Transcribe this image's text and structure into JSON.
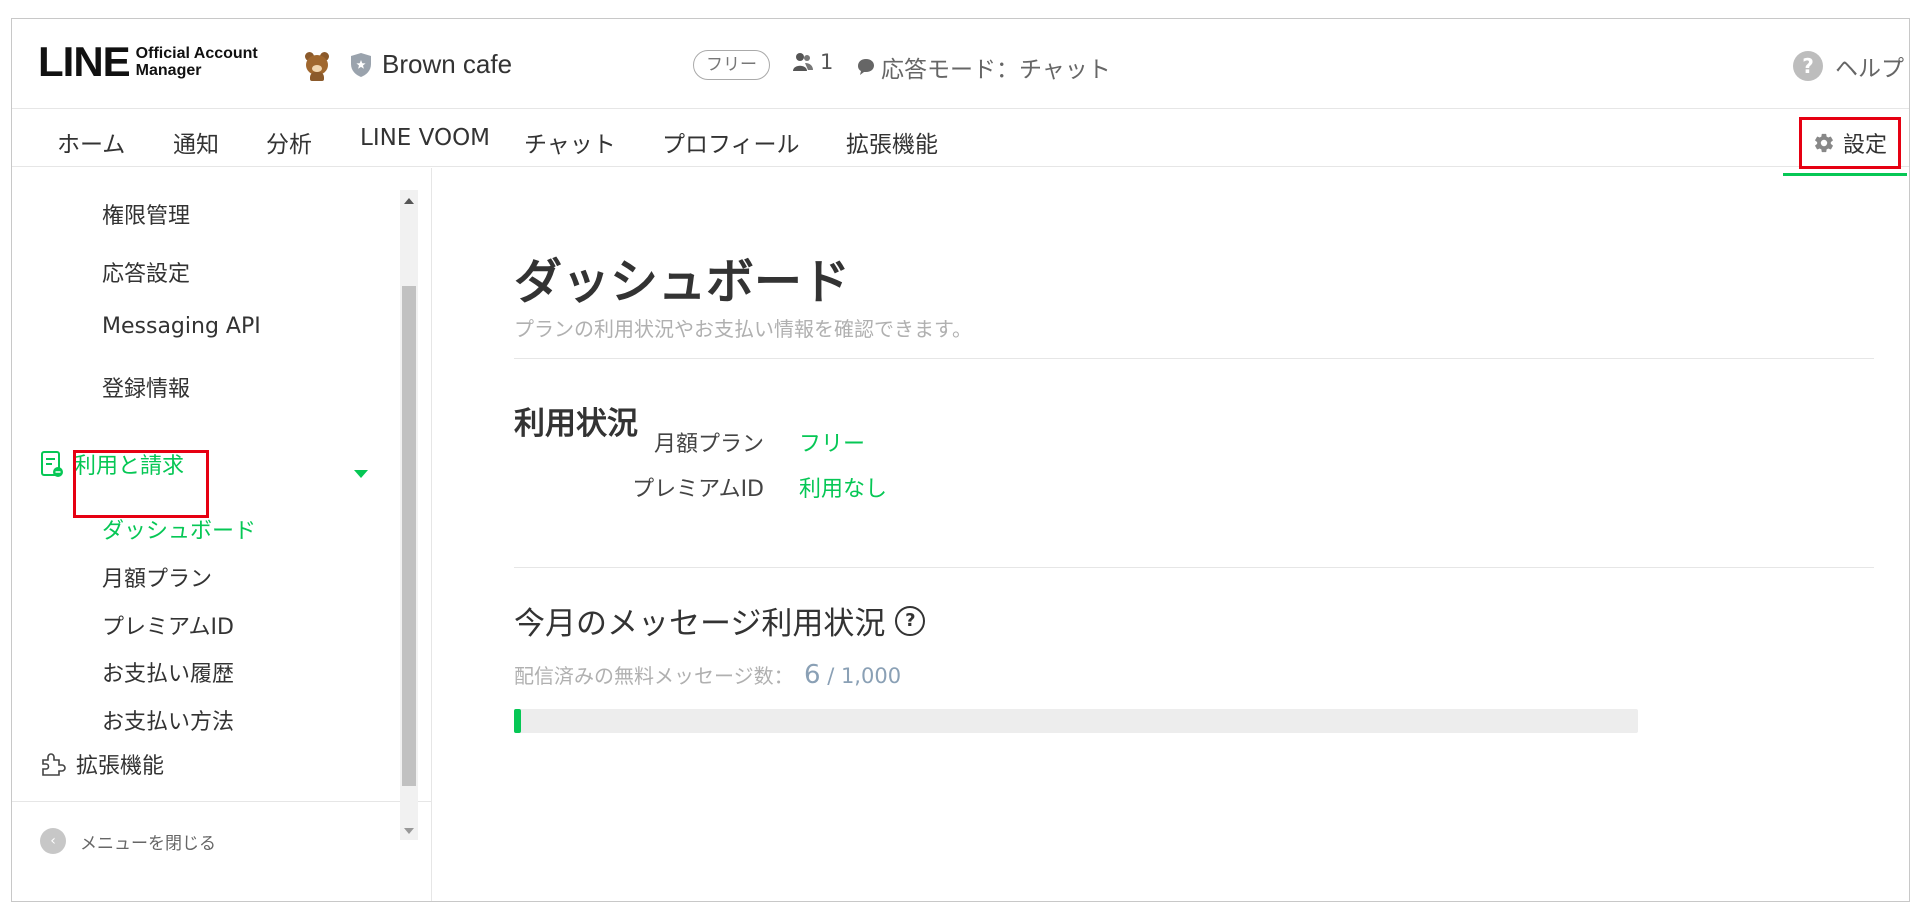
{
  "header": {
    "logo_main": "LINE",
    "logo_sub_line1": "Official Account",
    "logo_sub_line2": "Manager",
    "account_name": "Brown cafe",
    "plan_badge": "フリー",
    "friends_count": "1",
    "response_mode": "応答モード：チャット",
    "help": "ヘルプ"
  },
  "nav": {
    "items": [
      "ホーム",
      "通知",
      "分析",
      "LINE VOOM",
      "チャット",
      "プロフィール",
      "拡張機能"
    ],
    "settings": "設定"
  },
  "sidebar": {
    "items_top": [
      "権限管理",
      "応答設定",
      "Messaging API",
      "登録情報"
    ],
    "usage_section": "利用と請求",
    "usage_items": [
      "ダッシュボード",
      "月額プラン",
      "プレミアムID",
      "お支払い履歴",
      "お支払い方法"
    ],
    "extensions": "拡張機能",
    "close_menu": "メニューを閉じる"
  },
  "main": {
    "title": "ダッシュボード",
    "subtitle": "プランの利用状況やお支払い情報を確認できます。",
    "usage_heading": "利用状況",
    "rows": [
      {
        "label": "月額プラン",
        "value": "フリー"
      },
      {
        "label": "プレミアムID",
        "value": "利用なし"
      }
    ],
    "messages_heading": "今月のメッセージ利用状況",
    "delivered_label": "配信済みの無料メッセージ数：",
    "delivered_count": "6",
    "delivered_total": " / 1,000",
    "progress_fraction": 0.006
  },
  "colors": {
    "accent": "#06c755",
    "highlight": "#e60012"
  }
}
